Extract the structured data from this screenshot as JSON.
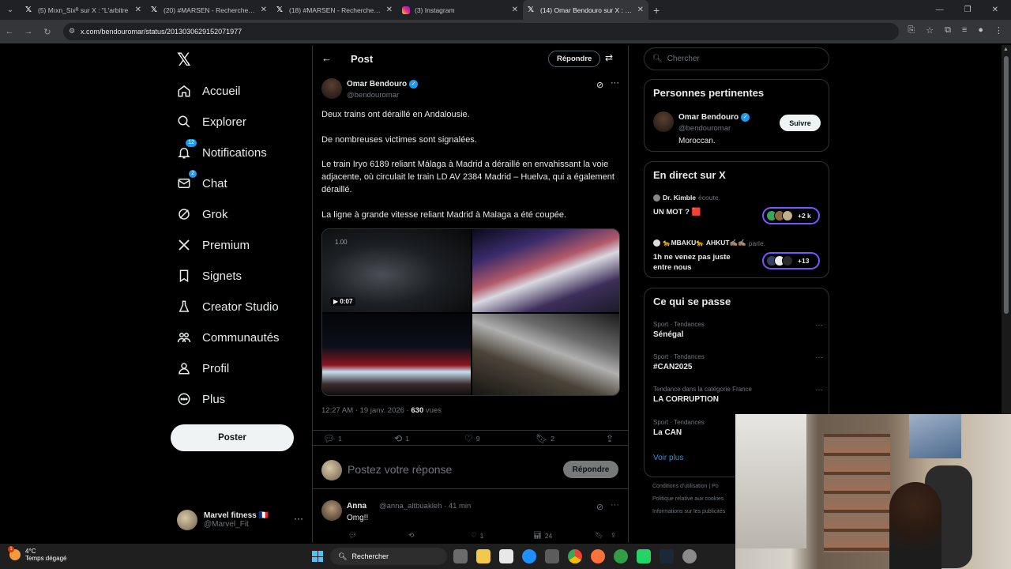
{
  "browser": {
    "tabs": [
      {
        "title": "(5) Mıxn_Sixᴿ sur X : \"L'arbitre",
        "active": false
      },
      {
        "title": "(20) #MARSEN - Recherche / X",
        "active": false
      },
      {
        "title": "(18) #MARSEN - Recherche / X",
        "active": false
      },
      {
        "title": "(3) Instagram",
        "active": false
      },
      {
        "title": "(14) Omar Bendouro sur X : \"De",
        "active": true
      }
    ],
    "url": "x.com/bendouromar/status/2013030629152071977"
  },
  "nav": {
    "logo": "𝕏",
    "items": [
      {
        "label": "Accueil",
        "icon": "home-icon"
      },
      {
        "label": "Explorer",
        "icon": "search-icon"
      },
      {
        "label": "Notifications",
        "icon": "bell-icon",
        "badge": "12"
      },
      {
        "label": "Chat",
        "icon": "mail-icon",
        "badge": "2"
      },
      {
        "label": "Grok",
        "icon": "grok-icon"
      },
      {
        "label": "Premium",
        "icon": "x-icon"
      },
      {
        "label": "Signets",
        "icon": "bookmark-icon"
      },
      {
        "label": "Creator Studio",
        "icon": "flask-icon"
      },
      {
        "label": "Communautés",
        "icon": "people-icon"
      },
      {
        "label": "Profil",
        "icon": "person-icon"
      },
      {
        "label": "Plus",
        "icon": "more-circle-icon"
      }
    ],
    "post_button": "Poster",
    "account": {
      "name": "Marvel fitness 🇫🇷",
      "handle": "@Marvel_Fit",
      "more": "···"
    }
  },
  "post": {
    "header_title": "Post",
    "reply_button": "Répondre",
    "author": {
      "name": "Omar Bendouro",
      "handle": "@bendouromar"
    },
    "paragraphs": [
      "Deux trains ont déraillé en Andalousie.",
      "De nombreuses victimes sont signalées.",
      "Le train Iryo 6189 reliant Málaga à Madrid a déraillé en envahissant la voie adjacente, où circulait le train LD AV 2384 Madrid – Huelva, qui a également déraillé.",
      "La ligne à grande vitesse reliant Madrid à Malaga a été coupée."
    ],
    "media": {
      "video_label": "1.00",
      "duration": "▶ 0:07"
    },
    "meta": {
      "time": "12:27 AM · 19 janv. 2026 · ",
      "views_count": "630",
      "views_label": " vues"
    },
    "stats": {
      "replies": "1",
      "reposts": "1",
      "likes": "9",
      "bookmarks": "2"
    },
    "compose_placeholder": "Postez votre réponse",
    "compose_button": "Répondre"
  },
  "reply": {
    "name": "Anna",
    "handle": "@anna_altbuakleh · 41 min",
    "text": "Omg!!",
    "likes": "1",
    "views": "24"
  },
  "right": {
    "search_placeholder": "Chercher",
    "people": {
      "title": "Personnes pertinentes",
      "name": "Omar Bendouro",
      "handle": "@bendouromar",
      "bio": "Moroccan.",
      "follow": "Suivre"
    },
    "live": {
      "title": "En direct sur X",
      "items": [
        {
          "host": "Dr. Kimble",
          "action": "écoute.",
          "title": "UN MOT ? 🟥",
          "count": "+2 k"
        },
        {
          "host": "🐆MBAKU🐆 AHKUT✍🏽✍🏽",
          "action": "parle.",
          "title": "1h ne venez pas juste entre nous",
          "count": "+13"
        }
      ]
    },
    "trends": {
      "title": "Ce qui se passe",
      "items": [
        {
          "context": "Sport · Tendances",
          "name": "Sénégal"
        },
        {
          "context": "Sport · Tendances",
          "name": "#CAN2025"
        },
        {
          "context": "Tendance dans la catégorie France",
          "name": "LA CORRUPTION"
        },
        {
          "context": "Sport · Tendances",
          "name": "La CAN"
        }
      ],
      "see_more": "Voir plus"
    },
    "footer": [
      "Conditions d'utilisation  |  Po",
      "Politique relative aux cookies",
      "Informations sur les publicités"
    ]
  },
  "taskbar": {
    "temp": "4°C",
    "weather": "Temps dégagé",
    "weather_badge": "1",
    "search": "Rechercher"
  },
  "colors": {
    "accent": "#1d9bf0",
    "live": "#7856ff",
    "border": "#2f3336",
    "muted": "#71767b"
  }
}
